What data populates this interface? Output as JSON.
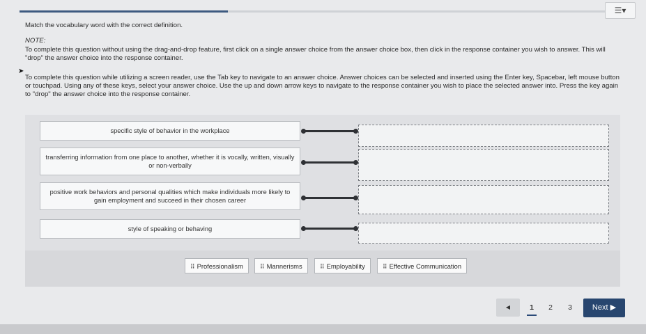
{
  "progress": {
    "fraction": 0.34
  },
  "menu": {
    "icon": "list-menu-icon",
    "glyph": "☰▾"
  },
  "instruction": "Match the vocabulary word with the correct definition.",
  "note": {
    "label": "NOTE:",
    "paragraph1": "To complete this question without using the drag-and-drop feature, first click on a single answer choice from the answer choice box, then click in the response container you wish to answer. This will \"drop\" the answer choice into the response container.",
    "paragraph2": "To complete this question while utilizing a screen reader, use the Tab key to navigate to an answer choice. Answer choices can be selected and inserted using the Enter key, Spacebar, left mouse button or touchpad. Using any of these keys, select your answer choice. Use the up and down arrow keys to navigate to the response container you wish to place the selected answer into. Press the key again to \"drop\" the answer choice into the response container."
  },
  "definitions": [
    "specific style of behavior in the workplace",
    "transferring information from one place to another, whether it is vocally, written, visually or non-verbally",
    "positive work behaviors and personal qualities which make individuals more likely to gain employment and succeed in their chosen career",
    "style of speaking or behaving"
  ],
  "choices": [
    "Professionalism",
    "Mannerisms",
    "Employability",
    "Effective Communication"
  ],
  "pagination": {
    "prev": "◀",
    "pages": [
      "1",
      "2",
      "3"
    ],
    "current": "1",
    "next": "Next ▶"
  }
}
